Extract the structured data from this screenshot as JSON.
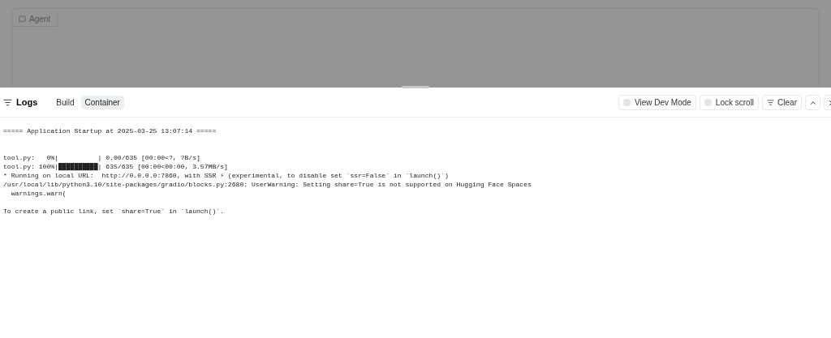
{
  "background_tab": {
    "label": "Agent"
  },
  "logs_panel": {
    "title": "Logs",
    "tabs": [
      {
        "label": "Build",
        "selected": false
      },
      {
        "label": "Container",
        "selected": true
      }
    ],
    "toggles": [
      {
        "label": "View Dev Mode",
        "checked": false
      },
      {
        "label": "Lock scroll",
        "checked": false
      }
    ],
    "clear_button": "Clear",
    "blocks": [
      {
        "kind": "banner",
        "lines": [
          "===== Application Startup at 2025-03-25 13:07:14 ====="
        ]
      },
      {
        "kind": "output",
        "lines": [
          "tool.py:   0%|          | 0.00/635 [00:00<?, ?B/s]",
          "tool.py: 100%|██████████| 635/635 [00:00<00:00, 3.57MB/s]",
          "* Running on local URL:  http://0.0.0.0:7860, with SSR ⚡ (experimental, to disable set `ssr=False` in `launch()`)",
          "/usr/local/lib/python3.10/site-packages/gradio/blocks.py:2680: UserWarning: Setting share=True is not supported on Hugging Face Spaces",
          "  warnings.warn("
        ]
      },
      {
        "kind": "output",
        "lines": [
          "To create a public link, set `share=True` in `launch()`."
        ]
      }
    ]
  }
}
